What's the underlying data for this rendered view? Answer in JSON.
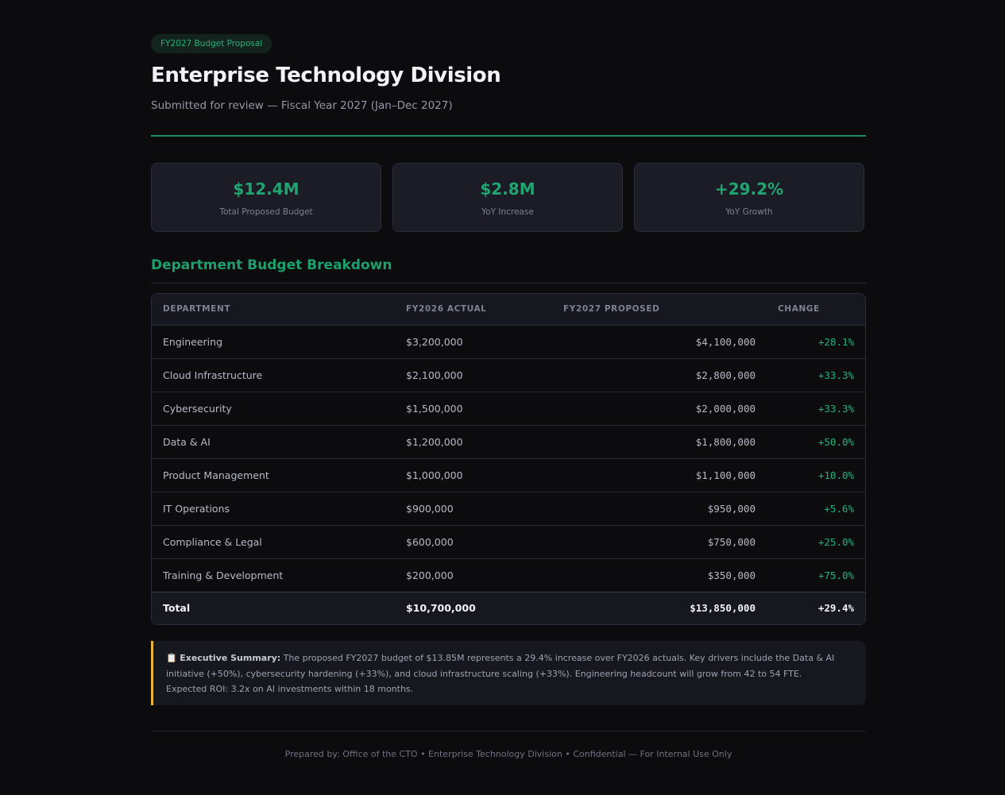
{
  "header": {
    "badge": "FY2027 Budget Proposal",
    "title": "Enterprise Technology Division",
    "subtitle": "Submitted for review — Fiscal Year 2027 (Jan–Dec 2027)"
  },
  "kpis": [
    {
      "value": "$12.4M",
      "label": "Total Proposed Budget"
    },
    {
      "value": "$2.8M",
      "label": "YoY Increase"
    },
    {
      "value": "+29.2%",
      "label": "YoY Growth"
    }
  ],
  "breakdown": {
    "title": "Department Budget Breakdown",
    "columns": [
      "DEPARTMENT",
      "FY2026 ACTUAL",
      "FY2027 PROPOSED",
      "CHANGE"
    ],
    "rows": [
      {
        "department": "Engineering",
        "actual": "$3,200,000",
        "proposed": "$4,100,000",
        "change": "+28.1%"
      },
      {
        "department": "Cloud Infrastructure",
        "actual": "$2,100,000",
        "proposed": "$2,800,000",
        "change": "+33.3%"
      },
      {
        "department": "Cybersecurity",
        "actual": "$1,500,000",
        "proposed": "$2,000,000",
        "change": "+33.3%"
      },
      {
        "department": "Data & AI",
        "actual": "$1,200,000",
        "proposed": "$1,800,000",
        "change": "+50.0%"
      },
      {
        "department": "Product Management",
        "actual": "$1,000,000",
        "proposed": "$1,100,000",
        "change": "+10.0%"
      },
      {
        "department": "IT Operations",
        "actual": "$900,000",
        "proposed": "$950,000",
        "change": "+5.6%"
      },
      {
        "department": "Compliance & Legal",
        "actual": "$600,000",
        "proposed": "$750,000",
        "change": "+25.0%"
      },
      {
        "department": "Training & Development",
        "actual": "$200,000",
        "proposed": "$350,000",
        "change": "+75.0%"
      }
    ],
    "total": {
      "department": "Total",
      "actual": "$10,700,000",
      "proposed": "$13,850,000",
      "change": "+29.4%"
    }
  },
  "summary": {
    "icon": "clipboard-icon",
    "label": "Executive Summary:",
    "text": " The proposed FY2027 budget of $13.85M represents a 29.4% increase over FY2026 actuals. Key drivers include the Data & AI initiative (+50%), cybersecurity hardening (+33%), and cloud infrastructure scaling (+33%). Engineering headcount will grow from 42 to 54 FTE. Expected ROI: 3.2x on AI investments within 18 months."
  },
  "footer": "Prepared by: Office of the CTO • Enterprise Technology Division • Confidential — For Internal Use Only",
  "colors": {
    "background": "#0c0c0f",
    "accent": "#20a570",
    "summary_border": "#eab634"
  }
}
